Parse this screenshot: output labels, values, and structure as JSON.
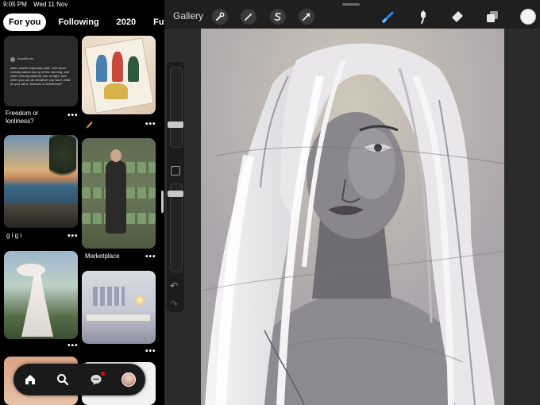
{
  "status_bar": {
    "time": "9:05 PM",
    "date": "Wed 11 Nov"
  },
  "pinterest": {
    "tabs": [
      {
        "label": "For you",
        "active": true
      },
      {
        "label": "Following",
        "active": false
      },
      {
        "label": "2020",
        "active": false
      },
      {
        "label": "Future H",
        "active": false
      }
    ],
    "pins": {
      "quote": {
        "title": "Freedom or lonliness?",
        "handle": "dead4hurts",
        "text": "when charlie ko(brook) said, \"and when nobody wakes you up in the morning, and when nobody waits for you at night, and when you can do whatever you want. what do you call it, freedom or loneliness?\""
      },
      "sea": {
        "title": "g i g i"
      },
      "cinema": {
        "title": "Marketplace"
      }
    },
    "more_symbol": "•••",
    "nav": {
      "home_icon": "home-icon",
      "search_icon": "search-icon",
      "messages_icon": "chat-bubble-icon",
      "profile_icon": "avatar",
      "notification_color": "#e60023"
    }
  },
  "procreate": {
    "gallery_label": "Gallery",
    "toolbar": {
      "left_tools": [
        "wrench-icon",
        "magic-wand-icon",
        "selection-s-icon",
        "transform-arrow-icon"
      ],
      "right_tools": [
        "brush-icon",
        "smudge-icon",
        "eraser-icon",
        "layers-icon",
        "color-swatch"
      ]
    },
    "accent_color": "#1e8cff",
    "current_color": "#f4f4f4",
    "undo_symbol": "↶",
    "redo_symbol": "↷"
  }
}
